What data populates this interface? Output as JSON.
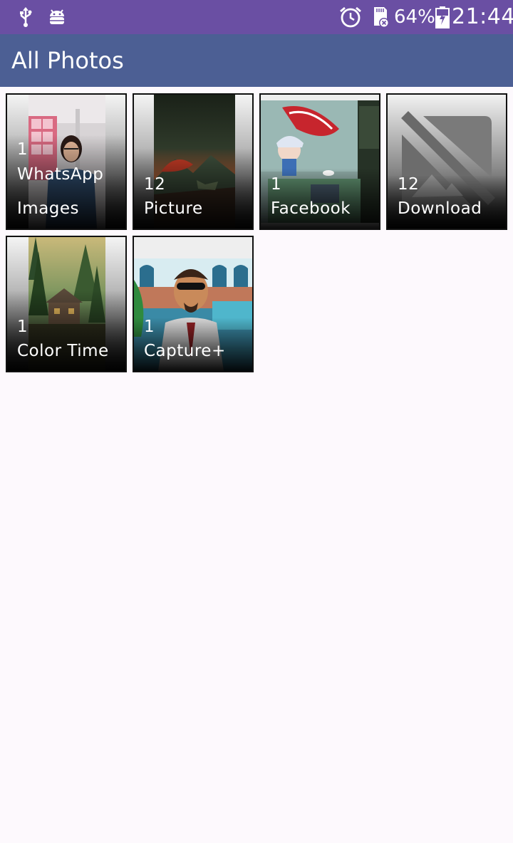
{
  "status_bar": {
    "battery_percent": "64%",
    "time": "21:44",
    "icons": [
      "usb-icon",
      "android-debug-icon",
      "alarm-icon",
      "sd-card-error-icon",
      "battery-charging-icon"
    ]
  },
  "app_bar": {
    "title": "All Photos"
  },
  "albums": [
    {
      "count": "1",
      "name_line1": "WhatsApp",
      "name_line2": "Images"
    },
    {
      "count": "12",
      "name": "Picture"
    },
    {
      "count": "1",
      "name": "Facebook"
    },
    {
      "count": "12",
      "name": "Download"
    },
    {
      "count": "1",
      "name": "Color Time"
    },
    {
      "count": "1",
      "name": "Capture+"
    }
  ]
}
